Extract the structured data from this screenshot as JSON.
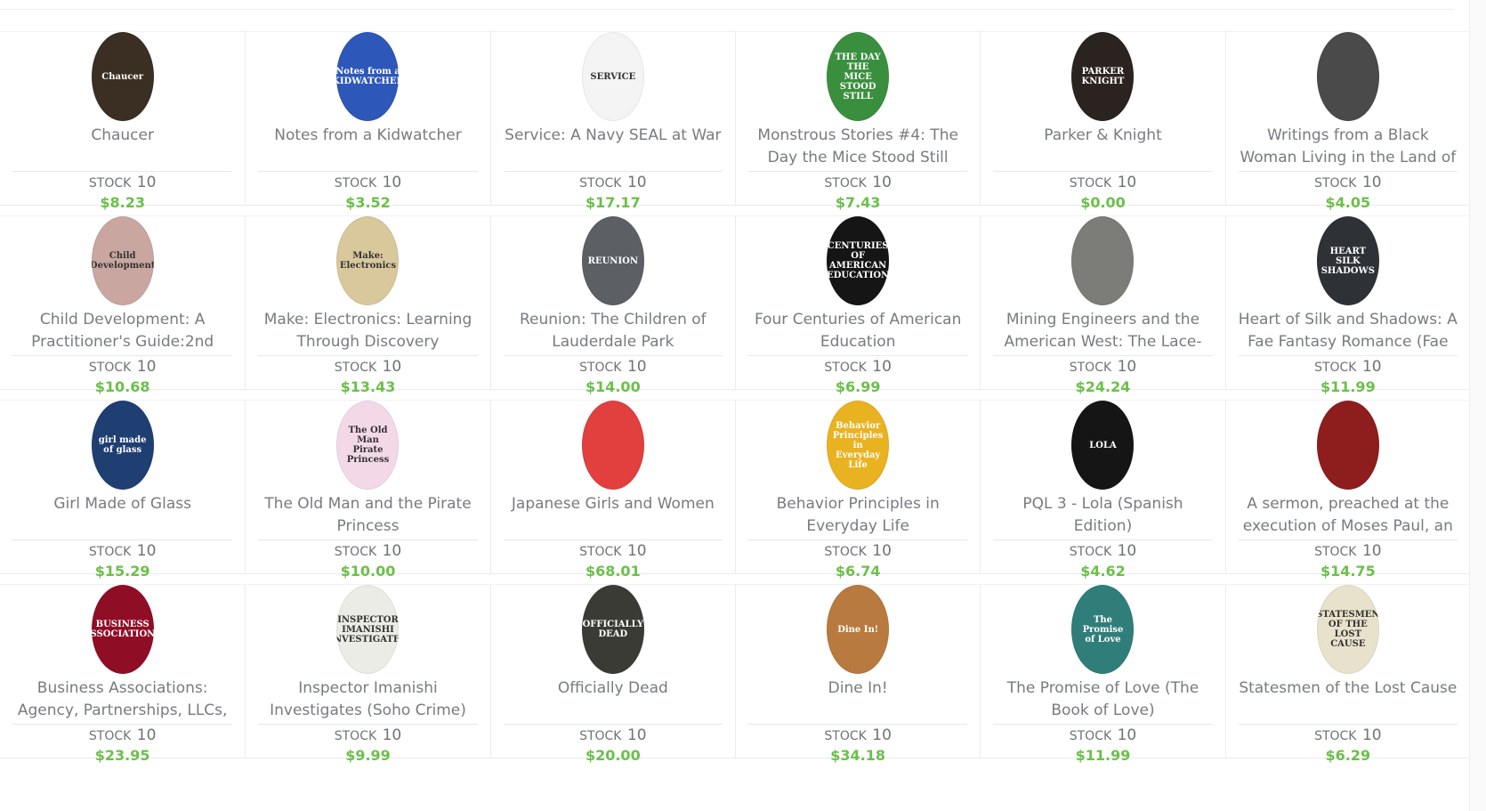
{
  "stock_label": "STOCK",
  "products": [
    {
      "title": "Chaucer",
      "stock": "10",
      "price": "$8.23",
      "cover_text": "Chaucer",
      "cover_color": "#3a2f22"
    },
    {
      "title": "Notes from a Kidwatcher",
      "stock": "10",
      "price": "$3.52",
      "cover_text": "Notes from a KIDWATCHER",
      "cover_color": "#2d57b8"
    },
    {
      "title": "Service: A Navy SEAL at War",
      "stock": "10",
      "price": "$17.17",
      "cover_text": "SERVICE",
      "cover_color": "#f4f4f4"
    },
    {
      "title": "Monstrous Stories #4: The Day the Mice Stood Still",
      "stock": "10",
      "price": "$7.43",
      "cover_text": "THE DAY THE MICE STOOD STILL",
      "cover_color": "#3a8f3e"
    },
    {
      "title": "Parker & Knight",
      "stock": "10",
      "price": "$0.00",
      "cover_text": "PARKER KNIGHT",
      "cover_color": "#2b2320"
    },
    {
      "title": "Writings from a Black Woman Living in the Land of the",
      "stock": "10",
      "price": "$4.05",
      "cover_text": "",
      "cover_color": "#4a4a4a"
    },
    {
      "title": "Child Development: A Practitioner's Guide:2nd",
      "stock": "10",
      "price": "$10.68",
      "cover_text": "Child Development",
      "cover_color": "#c9a6a0"
    },
    {
      "title": "Make: Electronics: Learning Through Discovery",
      "stock": "10",
      "price": "$13.43",
      "cover_text": "Make: Electronics",
      "cover_color": "#d9c89c"
    },
    {
      "title": "Reunion: The Children of Lauderdale Park",
      "stock": "10",
      "price": "$14.00",
      "cover_text": "REUNION",
      "cover_color": "#5c5f63"
    },
    {
      "title": "Four Centuries of American Education",
      "stock": "10",
      "price": "$6.99",
      "cover_text": "CENTURIES OF AMERICAN EDUCATION",
      "cover_color": "#151515"
    },
    {
      "title": "Mining Engineers and the American West: The Lace-Boot",
      "stock": "10",
      "price": "$24.24",
      "cover_text": "",
      "cover_color": "#7c7c78"
    },
    {
      "title": "Heart of Silk and Shadows: A Fae Fantasy Romance (Fae",
      "stock": "10",
      "price": "$11.99",
      "cover_text": "HEART SILK SHADOWS",
      "cover_color": "#2e3236"
    },
    {
      "title": "Girl Made of Glass",
      "stock": "10",
      "price": "$15.29",
      "cover_text": "girl made of glass",
      "cover_color": "#1f3e72"
    },
    {
      "title": "The Old Man and the Pirate Princess",
      "stock": "10",
      "price": "$10.00",
      "cover_text": "The Old Man Pirate Princess",
      "cover_color": "#f3d9e8"
    },
    {
      "title": "Japanese Girls and Women",
      "stock": "10",
      "price": "$68.01",
      "cover_text": "",
      "cover_color": "#e23f3f"
    },
    {
      "title": "Behavior Principles in Everyday Life",
      "stock": "10",
      "price": "$6.74",
      "cover_text": "Behavior Principles in Everyday Life",
      "cover_color": "#e9b220"
    },
    {
      "title": "PQL 3 - Lola (Spanish Edition)",
      "stock": "10",
      "price": "$4.62",
      "cover_text": "LOLA",
      "cover_color": "#151515"
    },
    {
      "title": "A sermon, preached at the execution of Moses Paul, an",
      "stock": "10",
      "price": "$14.75",
      "cover_text": "",
      "cover_color": "#8e1d1d"
    },
    {
      "title": "Business Associations: Agency, Partnerships, LLCs,",
      "stock": "10",
      "price": "$23.95",
      "cover_text": "BUSINESS ASSOCIATIONS",
      "cover_color": "#8f0e25"
    },
    {
      "title": "Inspector Imanishi Investigates (Soho Crime)",
      "stock": "10",
      "price": "$9.99",
      "cover_text": "INSPECTOR IMANISHI INVESTIGATES",
      "cover_color": "#ecece6"
    },
    {
      "title": "Officially Dead",
      "stock": "10",
      "price": "$20.00",
      "cover_text": "OFFICIALLY DEAD",
      "cover_color": "#3b3b36"
    },
    {
      "title": "Dine In!",
      "stock": "10",
      "price": "$34.18",
      "cover_text": "Dine In!",
      "cover_color": "#b87a3e"
    },
    {
      "title": "The Promise of Love (The Book of Love)",
      "stock": "10",
      "price": "$11.99",
      "cover_text": "The Promise of Love",
      "cover_color": "#2f7e7a"
    },
    {
      "title": "Statesmen of the Lost Cause",
      "stock": "10",
      "price": "$6.29",
      "cover_text": "STATESMEN OF THE LOST CAUSE",
      "cover_color": "#e8e2cc"
    }
  ]
}
